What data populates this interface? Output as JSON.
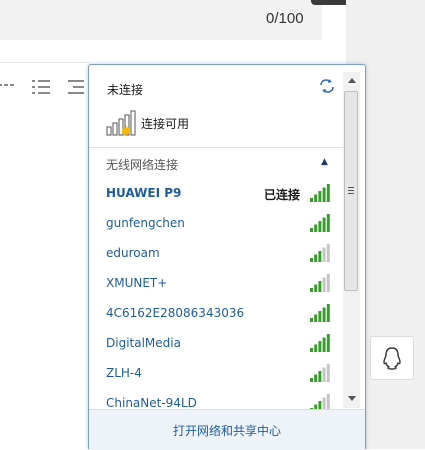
{
  "editor": {
    "char_count": "0/100"
  },
  "wifi_panel": {
    "status_label": "未连接",
    "connection_available": "连接可用",
    "section_label": "无线网络连接",
    "networks": [
      {
        "name": "HUAWEI P9",
        "status": "已连接",
        "signal_bars": 5,
        "active": true
      },
      {
        "name": "gunfengchen",
        "status": "",
        "signal_bars": 5,
        "active": false
      },
      {
        "name": "eduroam",
        "status": "",
        "signal_bars": 3,
        "active": false
      },
      {
        "name": "XMUNET+",
        "status": "",
        "signal_bars": 3,
        "active": false
      },
      {
        "name": "4C6162E28086343036",
        "status": "",
        "signal_bars": 5,
        "active": false
      },
      {
        "name": "DigitalMedia",
        "status": "",
        "signal_bars": 5,
        "active": false
      },
      {
        "name": "ZLH-4",
        "status": "",
        "signal_bars": 3,
        "active": false
      },
      {
        "name": "ChinaNet-94LD",
        "status": "",
        "signal_bars": 3,
        "active": false
      }
    ],
    "footer_link": "打开网络和共享中心"
  },
  "colors": {
    "link_blue": "#1f5d99",
    "signal_green": "#3b9c2e",
    "signal_gray": "#c4c4c4",
    "panel_border": "#7a9fc4",
    "footer_bg": "#eef3fa"
  },
  "icons": {
    "refresh": "refresh-icon",
    "collapse": "chevron-up-icon",
    "signal": "wifi-signal-icon",
    "qq": "qq-penguin-icon"
  }
}
